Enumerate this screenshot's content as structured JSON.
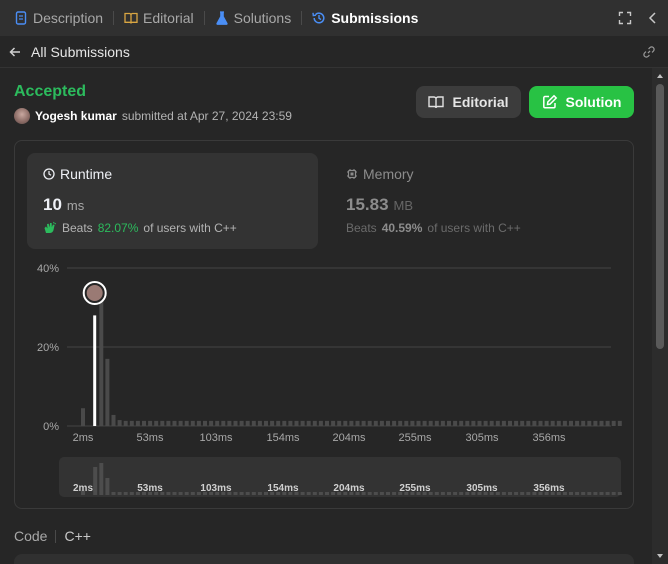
{
  "tabs": [
    {
      "label": "Description",
      "icon": "description-icon",
      "color": "#4a8ef5"
    },
    {
      "label": "Editorial",
      "icon": "book-icon",
      "color": "#d9a642"
    },
    {
      "label": "Solutions",
      "icon": "flask-icon",
      "color": "#4a8ef5"
    },
    {
      "label": "Submissions",
      "icon": "history-icon",
      "color": "#4a8ef5"
    }
  ],
  "active_tab": "Submissions",
  "back": {
    "label": "All Submissions"
  },
  "submission": {
    "status": "Accepted",
    "user": "Yogesh kumar",
    "submitted_text": "submitted at Apr 27, 2024 23:59"
  },
  "buttons": {
    "editorial": "Editorial",
    "solution": "Solution"
  },
  "runtime": {
    "title": "Runtime",
    "value": "10",
    "unit": "ms",
    "beats_label": "Beats",
    "beats_pct": "82.07%",
    "beats_suffix": "of users with C++"
  },
  "memory": {
    "title": "Memory",
    "value": "15.83",
    "unit": "MB",
    "beats_label": "Beats",
    "beats_pct": "40.59%",
    "beats_suffix": "of users with C++"
  },
  "code": {
    "label": "Code",
    "language": "C++"
  },
  "colors": {
    "accepted": "#2cbb5d",
    "solution_button": "#28c244",
    "bar": "#4a4a4a",
    "highlight_bar": "#ffffff"
  },
  "chart_data": {
    "type": "bar",
    "x_ticks": [
      "2ms",
      "53ms",
      "103ms",
      "154ms",
      "204ms",
      "255ms",
      "305ms",
      "356ms"
    ],
    "y_ticks": [
      "40%",
      "20%",
      "0%"
    ],
    "ylim": [
      0,
      40
    ],
    "highlight_index": 2,
    "values": [
      4.5,
      0,
      28,
      32,
      17,
      2.8,
      1.5,
      1.3,
      1.3,
      1.3,
      1.3,
      1.3,
      1.3,
      1.3,
      1.3,
      1.3,
      1.3,
      1.3,
      1.3,
      1.3,
      1.3,
      1.3,
      1.3,
      1.3,
      1.3,
      1.3,
      1.3,
      1.3,
      1.3,
      1.3,
      1.3,
      1.3,
      1.3,
      1.3,
      1.3,
      1.3,
      1.3,
      1.3,
      1.3,
      1.3,
      1.3,
      1.3,
      1.3,
      1.3,
      1.3,
      1.3,
      1.3,
      1.3,
      1.3,
      1.3,
      1.3,
      1.3,
      1.3,
      1.3,
      1.3,
      1.3,
      1.3,
      1.3,
      1.3,
      1.3,
      1.3,
      1.3,
      1.3,
      1.3,
      1.3,
      1.3,
      1.3,
      1.3,
      1.3,
      1.3,
      1.3,
      1.3,
      1.3,
      1.3,
      1.3,
      1.3,
      1.3,
      1.3,
      1.3,
      1.3,
      1.3,
      1.3,
      1.3,
      1.3,
      1.3,
      1.3,
      1.3,
      1.3,
      1.3
    ]
  }
}
